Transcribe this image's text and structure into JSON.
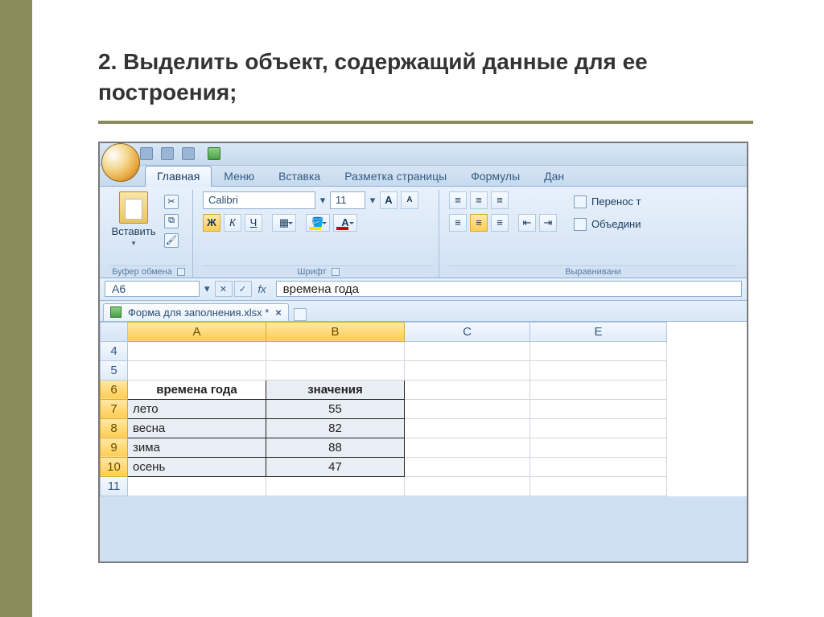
{
  "slide": {
    "title": "2. Выделить объект, содержащий данные для ее построения;"
  },
  "ribbon": {
    "tabs": [
      "Главная",
      "Меню",
      "Вставка",
      "Разметка страницы",
      "Формулы",
      "Дан"
    ],
    "active_tab": "Главная",
    "clipboard": {
      "paste": "Вставить",
      "label": "Буфер обмена"
    },
    "font": {
      "name": "Calibri",
      "size": "11",
      "label": "Шрифт",
      "bold": "Ж",
      "italic": "К",
      "underline": "Ч"
    },
    "alignment": {
      "label": "Выравнивани",
      "wrap": "Перенос т",
      "merge": "Объедини"
    }
  },
  "formula_bar": {
    "cell_ref": "A6",
    "value": "времена года"
  },
  "document": {
    "filename": "Форма для заполнения.xlsx *"
  },
  "sheet": {
    "columns": [
      "A",
      "B",
      "C",
      "E"
    ],
    "rows": [
      "4",
      "5",
      "6",
      "7",
      "8",
      "9",
      "10",
      "11"
    ],
    "header": {
      "a": "времена года",
      "b": "значения"
    },
    "data": [
      {
        "a": "лето",
        "b": "55"
      },
      {
        "a": "весна",
        "b": "82"
      },
      {
        "a": "зима",
        "b": "88"
      },
      {
        "a": "осень",
        "b": "47"
      }
    ]
  },
  "chart_data": {
    "type": "table",
    "title": "времена года / значения",
    "categories": [
      "лето",
      "весна",
      "зима",
      "осень"
    ],
    "values": [
      55,
      82,
      88,
      47
    ]
  }
}
